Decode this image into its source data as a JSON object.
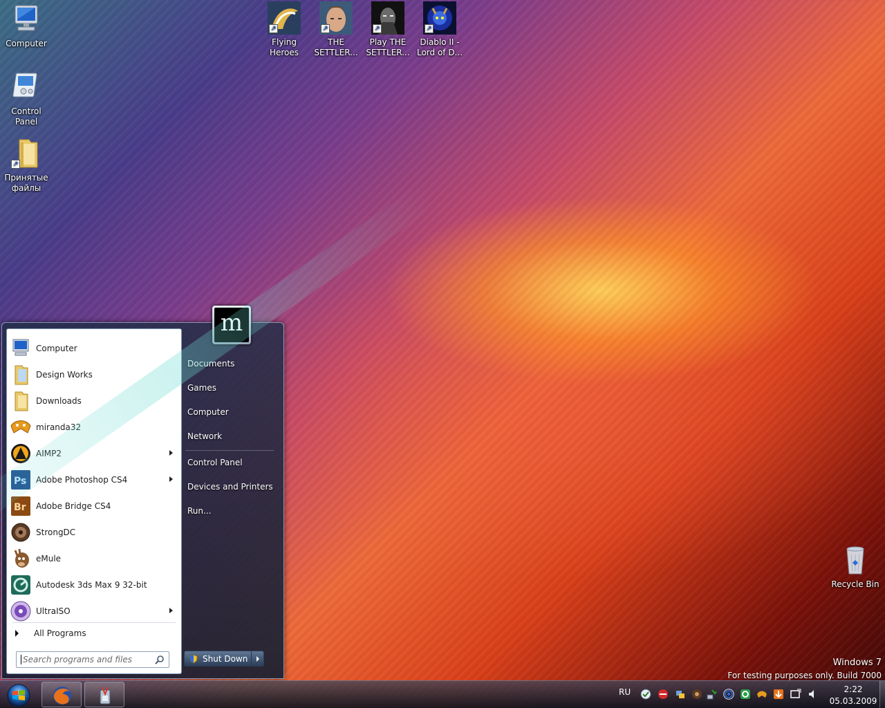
{
  "desktop": {
    "icons": [
      {
        "label": "Computer"
      },
      {
        "label": "Control Panel"
      },
      {
        "label": "Принятые файлы"
      },
      {
        "label": "Flying Heroes"
      },
      {
        "label": "THE SETTLER..."
      },
      {
        "label": "Play THE SETTLER..."
      },
      {
        "label": "Diablo II - Lord of D..."
      },
      {
        "label": "Recycle Bin"
      }
    ]
  },
  "start_menu": {
    "programs": [
      {
        "label": "Computer",
        "icon": "computer-icon",
        "submenu": false
      },
      {
        "label": "Design Works",
        "icon": "folder-icon",
        "submenu": false
      },
      {
        "label": "Downloads",
        "icon": "folder-icon",
        "submenu": false
      },
      {
        "label": "miranda32",
        "icon": "miranda-icon",
        "submenu": false
      },
      {
        "label": "AIMP2",
        "icon": "aimp-icon",
        "submenu": true
      },
      {
        "label": "Adobe Photoshop CS4",
        "icon": "photoshop-icon",
        "submenu": true
      },
      {
        "label": "Adobe Bridge CS4",
        "icon": "bridge-icon",
        "submenu": false
      },
      {
        "label": "StrongDC",
        "icon": "strongdc-icon",
        "submenu": false
      },
      {
        "label": "eMule",
        "icon": "emule-icon",
        "submenu": false
      },
      {
        "label": "Autodesk 3ds Max 9 32-bit",
        "icon": "3dsmax-icon",
        "submenu": false
      },
      {
        "label": "UltraISO",
        "icon": "ultraiso-icon",
        "submenu": true
      }
    ],
    "all_programs": "All Programs",
    "search_placeholder": "Search programs and files",
    "right_items": [
      "Documents",
      "Games",
      "Computer",
      "Network",
      "Control Panel",
      "Devices and Printers",
      "Run..."
    ],
    "user_picture_text": "m",
    "shutdown_label": "Shut Down"
  },
  "watermark": {
    "line1": "Windows 7",
    "line2": "For testing purposes only. Build 7000"
  },
  "taskbar": {
    "language": "RU",
    "time": "2:22",
    "date": "05.03.2009",
    "pinned": [
      "firefox-icon",
      "app-icon"
    ]
  },
  "colors": {
    "menu_bg": "#1e2d46",
    "accent_blue": "#1a56c8",
    "photoshop_blue": "#1f4f8f",
    "bridge_orange": "#8a4a12"
  }
}
